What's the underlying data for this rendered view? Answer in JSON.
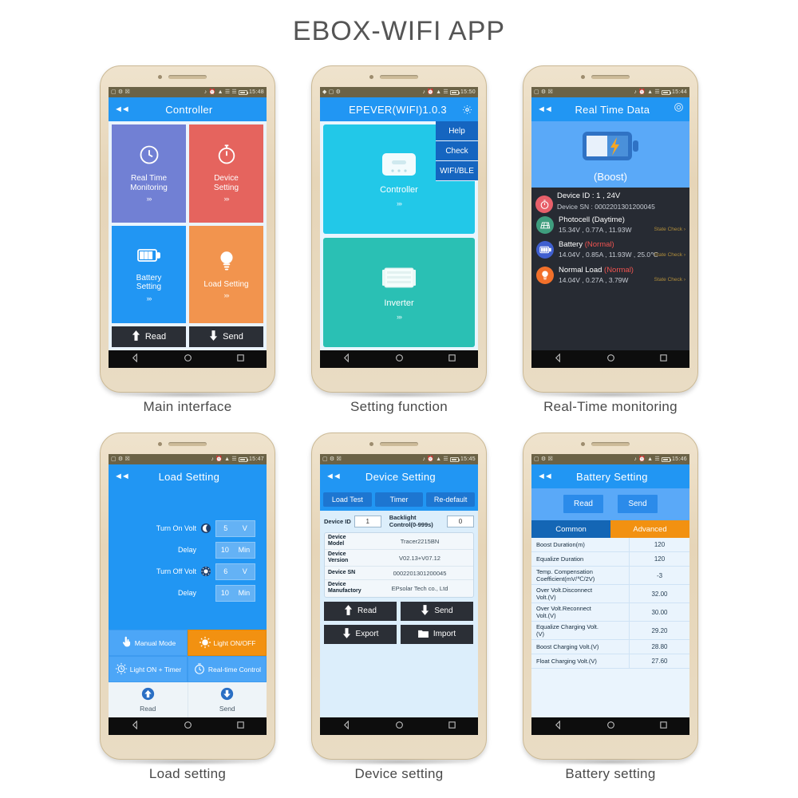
{
  "page": {
    "title": "EBOX-WIFI    APP"
  },
  "phones": [
    {
      "caption": "Main interface",
      "status": {
        "time": "15:48"
      },
      "appbar": {
        "title": "Controller",
        "back_icon": "back-arrows-icon"
      },
      "tiles": [
        {
          "label": "Real Time\nMonitoring",
          "icon": "clock-icon",
          "color": "#7180d4",
          "chevron": "»›"
        },
        {
          "label": "Device\nSetting",
          "icon": "stopwatch-icon",
          "color": "#e5645e",
          "chevron": "»›"
        },
        {
          "label": "Battery\nSetting",
          "icon": "battery-icon",
          "color": "#2196f3",
          "chevron": "»›"
        },
        {
          "label": "Load Setting",
          "icon": "bulb-icon",
          "color": "#f2944e",
          "chevron": "»›"
        }
      ],
      "buttons": [
        {
          "label": "Read",
          "icon": "up-arrow-icon"
        },
        {
          "label": "Send",
          "icon": "down-arrow-icon"
        }
      ]
    },
    {
      "caption": "Setting function",
      "status": {
        "time": "15:50"
      },
      "appbar": {
        "title": "EPEVER(WIFI)1.0.3",
        "gear_icon": "gear-icon"
      },
      "menu": [
        "Help",
        "Check",
        "WIFI/BLE"
      ],
      "tiles": [
        {
          "label": "Controller",
          "icon": "controller-device-icon",
          "color": "#22c8e8",
          "chevron": "»›"
        },
        {
          "label": "Inverter",
          "icon": "inverter-device-icon",
          "color": "#2ac0b4",
          "chevron": "»›"
        }
      ]
    },
    {
      "caption": "Real-Time monitoring",
      "status": {
        "time": "15:44"
      },
      "appbar": {
        "title": "Real Time Data",
        "back_icon": "back-arrows-icon",
        "right_icon": "refresh-icon"
      },
      "hero": {
        "mode": "(Boost)",
        "icon": "battery-charging-icon"
      },
      "device": {
        "id_line": "Device ID : 1 , 24V",
        "sn_line": "Device SN : 0002201301200045",
        "icon": "stopwatch-icon"
      },
      "rows": [
        {
          "title": "Photocell",
          "state": "(Daytime)",
          "state_color": "#ffffff",
          "values": "15.34V , 0.77A , 11.93W",
          "icon": "solar-panel-icon",
          "icon_color": "#3f9e7e",
          "check": "State Check ›"
        },
        {
          "title": "Battery",
          "state": "(Normal)",
          "state_color": "#ef5350",
          "values": "14.04V , 0.85A , 11.93W , 25.0℃",
          "icon": "battery-icon",
          "icon_color": "#3f5fd0",
          "check": "State Check ›"
        },
        {
          "title": "Normal Load",
          "state": "(Normal)",
          "state_color": "#ef5350",
          "values": "14.04V , 0.27A , 3.79W",
          "icon": "bulb-icon",
          "icon_color": "#f2702a",
          "check": "State Check ›"
        }
      ]
    },
    {
      "caption": "Load setting",
      "status": {
        "time": "15:47"
      },
      "appbar": {
        "title": "Load Setting",
        "back_icon": "back-arrows-icon"
      },
      "fields": [
        {
          "label": "Turn On Volt",
          "icon": "moon-icon",
          "value": "5",
          "unit": "V"
        },
        {
          "label": "Delay",
          "icon": "",
          "value": "10",
          "unit": "Min"
        },
        {
          "label": "Turn Off Volt",
          "icon": "sun-icon",
          "value": "6",
          "unit": "V"
        },
        {
          "label": "Delay",
          "icon": "",
          "value": "10",
          "unit": "Min"
        }
      ],
      "modes": [
        {
          "label": "Manual Mode",
          "icon": "hand-tap-icon",
          "active": false
        },
        {
          "label": "Light ON/OFF",
          "icon": "sun-icon",
          "active": true
        },
        {
          "label": "Light ON + Timer",
          "icon": "sun-clock-icon",
          "active": false
        },
        {
          "label": "Real-time Control",
          "icon": "clock-icon",
          "active": false
        }
      ],
      "buttons": [
        {
          "label": "Read",
          "icon": "up-arrow-circle-icon"
        },
        {
          "label": "Send",
          "icon": "down-arrow-circle-icon"
        }
      ]
    },
    {
      "caption": "Device setting",
      "status": {
        "time": "15:45"
      },
      "appbar": {
        "title": "Device Setting",
        "back_icon": "back-arrows-icon"
      },
      "tabs": [
        "Load Test",
        "Timer",
        "Re-default"
      ],
      "inputs": [
        {
          "label": "Device ID",
          "value": "1"
        },
        {
          "label": "Backlight\nControl(0-999s)",
          "value": "0"
        }
      ],
      "info_rows": [
        {
          "key": "Device Model",
          "value": "Tracer2215BN"
        },
        {
          "key": "Device\nVersion",
          "value": "V02.13+V07.12"
        },
        {
          "key": "Device SN",
          "value": "0002201301200045"
        },
        {
          "key": "Device\nManufactory",
          "value": "EPsolar Tech co., Ltd"
        }
      ],
      "buttons": [
        {
          "label": "Read",
          "icon": "up-arrow-icon"
        },
        {
          "label": "Send",
          "icon": "down-arrow-icon"
        },
        {
          "label": "Export",
          "icon": "down-arrow-icon"
        },
        {
          "label": "Import",
          "icon": "folder-icon"
        }
      ]
    },
    {
      "caption": "Battery setting",
      "status": {
        "time": "15:46"
      },
      "appbar": {
        "title": "Battery Setting",
        "back_icon": "back-arrows-icon"
      },
      "buttons": [
        {
          "label": "Read"
        },
        {
          "label": "Send"
        }
      ],
      "tabs": [
        {
          "label": "Common",
          "active": true
        },
        {
          "label": "Advanced",
          "active": false
        }
      ],
      "table": {
        "rows": [
          {
            "key": "Boost Duration(m)",
            "value": "120"
          },
          {
            "key": "Equalize Duration",
            "value": "120"
          },
          {
            "key": "Temp. Compensation\nCoefficient(mV/℃/2V)",
            "value": "-3"
          },
          {
            "key": "Over Volt.Disconnect\nVolt.(V)",
            "value": "32.00"
          },
          {
            "key": "Over Volt.Reconnect\nVolt.(V)",
            "value": "30.00"
          },
          {
            "key": "Equalize Charging Volt.\n(V)",
            "value": "29.20"
          },
          {
            "key": "Boost Charging Volt.(V)",
            "value": "28.80"
          },
          {
            "key": "Float Charging Volt.(V)",
            "value": "27.60"
          }
        ]
      }
    }
  ]
}
